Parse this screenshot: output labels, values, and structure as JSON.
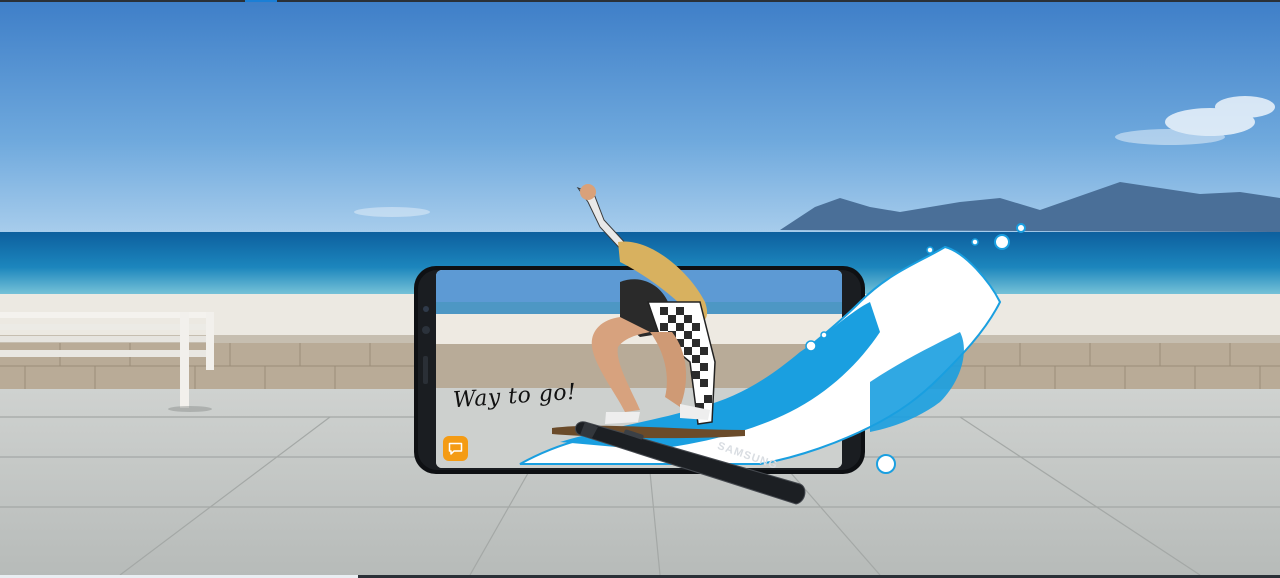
{
  "scene": {
    "handwriting": "Way to go!",
    "pen_brand": "SAMSUNG"
  },
  "icons": {
    "app_icon": "chat-bubble-icon"
  },
  "colors": {
    "accent_indicator": "#1b7fd6",
    "app_icon": "#f49b14",
    "splash": "#1a9fe0"
  },
  "slider": {
    "progress_fraction": 0.28
  }
}
